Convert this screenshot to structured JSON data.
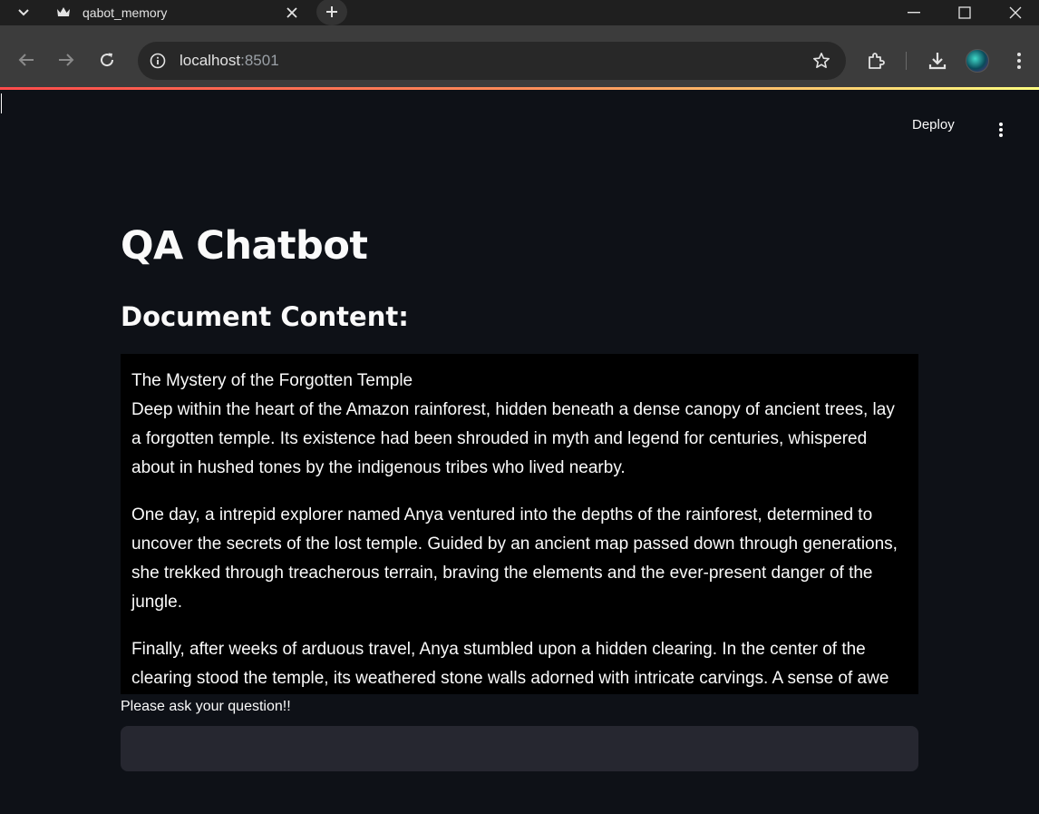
{
  "browser": {
    "tab_title": "qabot_memory",
    "url_host": "localhost",
    "url_port": ":8501"
  },
  "app": {
    "deploy_label": "Deploy",
    "title": "QA Chatbot",
    "subheader": "Document Content:",
    "document": {
      "title_line": "The Mystery of the Forgotten Temple",
      "paragraphs": [
        "Deep within the heart of the Amazon rainforest, hidden beneath a dense canopy of ancient trees, lay a forgotten temple. Its existence had been shrouded in myth and legend for centuries, whispered about in hushed tones by the indigenous tribes who lived nearby.",
        "One day, a intrepid explorer named Anya ventured into the depths of the rainforest, determined to uncover the secrets of the lost temple. Guided by an ancient map passed down through generations, she trekked through treacherous terrain, braving the elements and the ever-present danger of the jungle.",
        "Finally, after weeks of arduous travel, Anya stumbled upon a hidden clearing. In the center of the clearing stood the temple, its weathered stone walls adorned with intricate carvings. A sense of awe"
      ]
    },
    "question_label": "Please ask your question!!",
    "question_value": ""
  }
}
